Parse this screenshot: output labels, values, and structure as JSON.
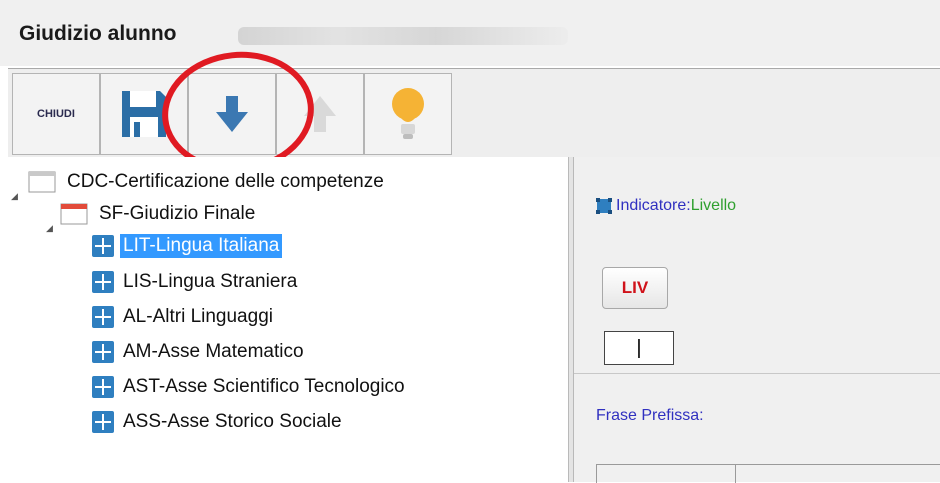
{
  "window": {
    "title": "Giudizio alunno"
  },
  "toolbar": {
    "close_label": "CHIUDI",
    "buttons": [
      {
        "name": "save",
        "icon": "floppy-disk-icon",
        "color": "#2b6ea6"
      },
      {
        "name": "download",
        "icon": "arrow-down-icon",
        "color": "#3b78b2"
      },
      {
        "name": "upload",
        "icon": "arrow-up-icon",
        "color": "#d9d9d9",
        "disabled": true
      },
      {
        "name": "hint",
        "icon": "lightbulb-icon",
        "color": "#f5b335"
      }
    ],
    "highlight_color": "#e01a22"
  },
  "tree": {
    "root": {
      "label": "CDC-Certificazione delle competenze",
      "icon": "document-icon"
    },
    "child": {
      "label": "SF-Giudizio Finale",
      "icon": "calendar-icon"
    },
    "items": [
      {
        "label": "LIT-Lingua Italiana",
        "selected": true
      },
      {
        "label": "LIS-Lingua Straniera",
        "selected": false
      },
      {
        "label": "AL-Altri Linguaggi",
        "selected": false
      },
      {
        "label": "AM-Asse Matematico",
        "selected": false
      },
      {
        "label": "AST-Asse Scientifico Tecnologico",
        "selected": false
      },
      {
        "label": "ASS-Asse Storico Sociale",
        "selected": false
      }
    ],
    "selection_color": "#3399ff"
  },
  "detail": {
    "indicator_key": "Indicatore:",
    "indicator_value": "Livello",
    "liv_button": "LIV",
    "liv_value": "|",
    "prefix_label": "Frase Prefissa:"
  }
}
